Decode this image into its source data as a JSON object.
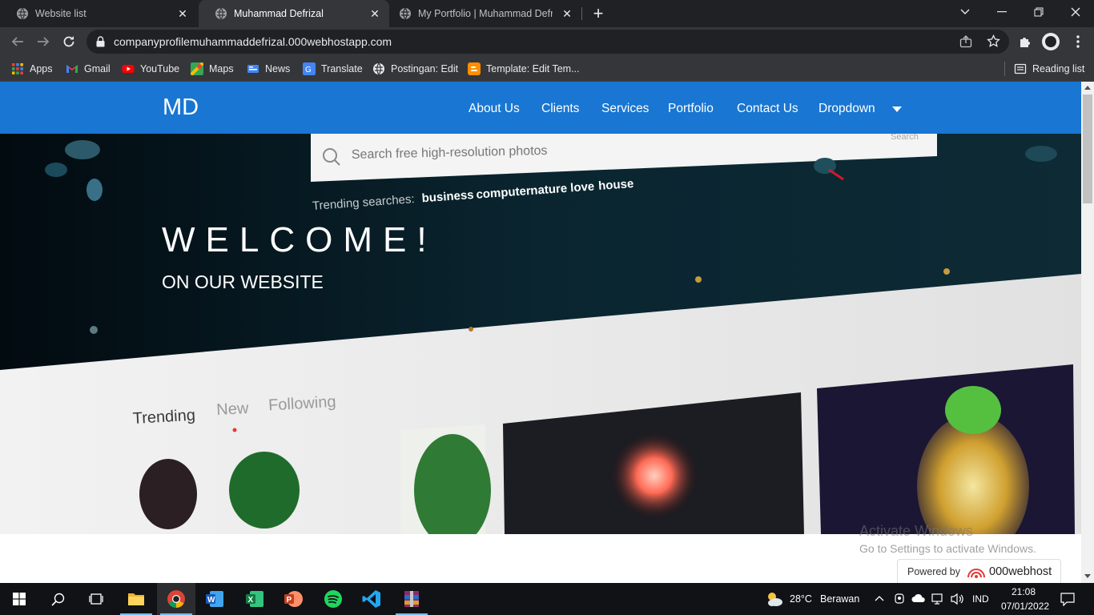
{
  "browser": {
    "tabs": [
      {
        "title": "Website list"
      },
      {
        "title": "Muhammad Defrizal"
      },
      {
        "title": "My Portfolio | Muhammad Defriz"
      }
    ],
    "url": "companyprofilemuhammaddefrizal.000webhostapp.com",
    "bookmarks": [
      "Apps",
      "Gmail",
      "YouTube",
      "Maps",
      "News",
      "Translate",
      "Postingan: Edit",
      "Template: Edit Tem..."
    ],
    "reading_list": "Reading list"
  },
  "site": {
    "brand": "MD",
    "nav": [
      "About Us",
      "Clients",
      "Services",
      "Portfolio",
      "Contact Us",
      "Dropdown"
    ],
    "hero_title": "WELCOME!",
    "hero_subtitle": "ON OUR WEBSITE",
    "bg": {
      "search_placeholder": "Search free high-resolution photos",
      "search_button": "Search",
      "trending_prefix": "Trending searches:",
      "trending_terms": [
        "business",
        "computer",
        "nature",
        "love",
        "house"
      ],
      "tabs": [
        "Trending",
        "New",
        "Following"
      ]
    }
  },
  "overlay": {
    "activate_title": "Activate Windows",
    "activate_sub": "Go to Settings to activate Windows.",
    "powered_by": "Powered by",
    "host_brand": "000webhost"
  },
  "taskbar": {
    "temperature": "28°C",
    "weather": "Berawan",
    "language": "IND",
    "time": "21:08",
    "date": "07/01/2022"
  },
  "colors": {
    "navbar": "#1976d2",
    "chrome_dark": "#202124",
    "chrome_toolbar": "#35363a",
    "taskbar": "#101215"
  }
}
